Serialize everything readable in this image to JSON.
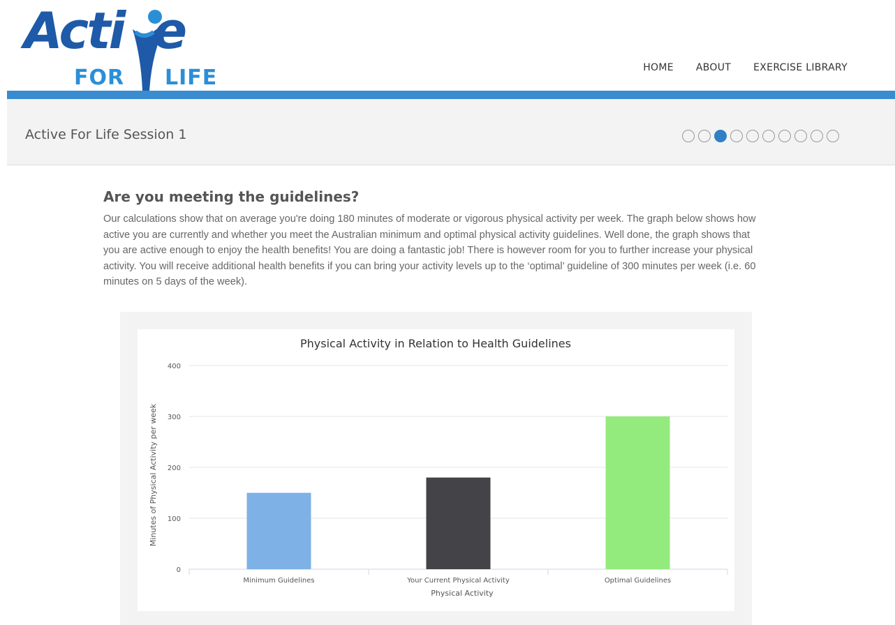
{
  "brand": {
    "logo_word": "Acti",
    "logo_word_end": "e",
    "logo_for": "FOR",
    "logo_life": "LIFE",
    "colors": {
      "logo_dark": "#1e5aa8",
      "logo_light": "#2b8fd8",
      "accent": "#3a8cd0"
    }
  },
  "nav": {
    "items": [
      {
        "label": "HOME"
      },
      {
        "label": "ABOUT"
      },
      {
        "label": "EXERCISE LIBRARY"
      }
    ]
  },
  "session": {
    "title": "Active For Life Session 1",
    "progress": {
      "total_steps": 10,
      "current_step": 3
    }
  },
  "main": {
    "heading": "Are you meeting the guidelines?",
    "paragraph": "Our calculations show that on average you're doing 180 minutes of moderate or vigorous physical activity per week. The graph below shows how active you are currently and whether you meet the Australian minimum and optimal physical activity guidelines. Well done, the graph shows that you are active enough to enjoy the health benefits! You are doing a fantastic job! There is however room for you to further increase your physical activity. You will receive additional health benefits if you can bring your activity levels up to the ‘optimal’ guideline of 300 minutes per week (i.e. 60 minutes on 5 days of the week)."
  },
  "chart_data": {
    "type": "bar",
    "title": "Physical Activity in Relation to Health Guidelines",
    "xlabel": "Physical Activity",
    "ylabel": "Minutes of Physical Activity per week",
    "categories": [
      "Minimum Guidelines",
      "Your Current Physical Activity",
      "Optimal Guidelines"
    ],
    "values": [
      150,
      180,
      300
    ],
    "colors": [
      "#7eb1e6",
      "#434348",
      "#94eb7d"
    ],
    "ylim": [
      0,
      400
    ],
    "yticks": [
      0,
      100,
      200,
      300,
      400
    ],
    "grid": true,
    "legend": "none"
  }
}
